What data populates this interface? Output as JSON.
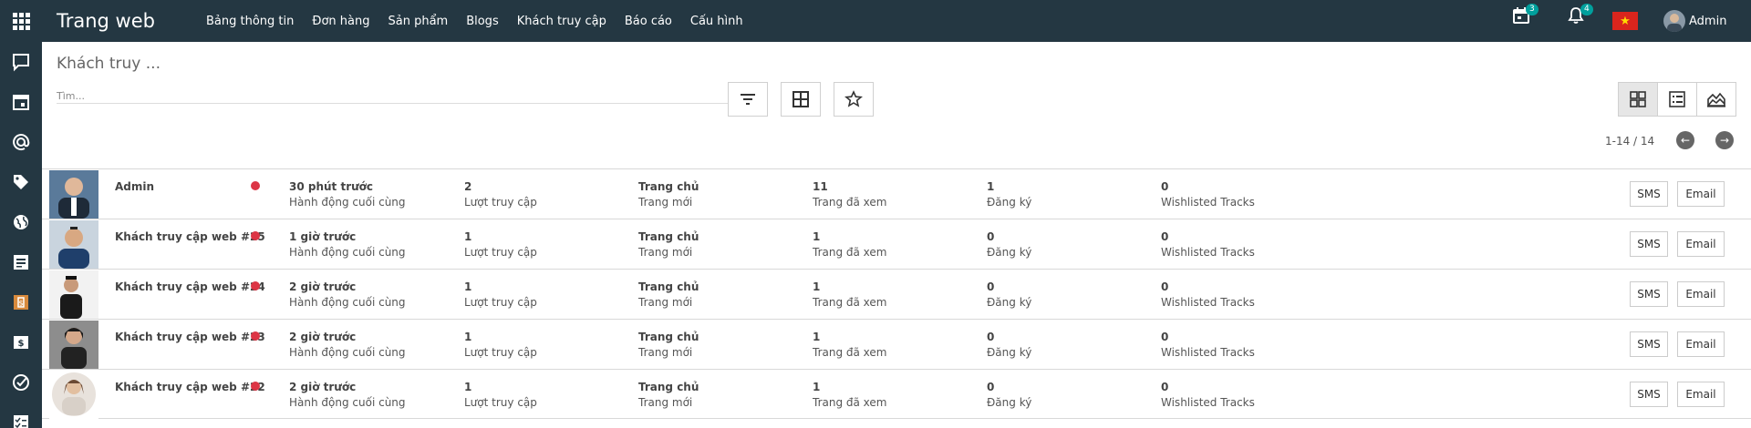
{
  "app": {
    "title": "Trang web",
    "apps_icon": "apps-grid-icon"
  },
  "menu": [
    "Bảng thông tin",
    "Đơn hàng",
    "Sản phẩm",
    "Blogs",
    "Khách truy cập",
    "Báo cáo",
    "Cấu hình"
  ],
  "systray": {
    "activity_count": "3",
    "notification_count": "4",
    "user_name": "Admin"
  },
  "sidebar": [
    "chat-icon",
    "calendar-icon",
    "at-icon",
    "tag-icon",
    "globe-icon",
    "document-icon",
    "clipboard-icon",
    "money-icon",
    "check-circle-icon",
    "tasks-icon"
  ],
  "control": {
    "title": "Khách truy ...",
    "search_placeholder": "Tìm...",
    "search_tail": "_ ·",
    "pager": "1-14 / 14"
  },
  "rows": [
    {
      "name": "Admin",
      "last_action": "30 phút trước",
      "visits": "2",
      "page": "Trang chủ",
      "pages_viewed": "11",
      "registrations": "1",
      "wishlisted": "0"
    },
    {
      "name": "Khách truy cập web #25",
      "last_action": "1 giờ trước",
      "visits": "1",
      "page": "Trang chủ",
      "pages_viewed": "1",
      "registrations": "0",
      "wishlisted": "0"
    },
    {
      "name": "Khách truy cập web #24",
      "last_action": "2 giờ trước",
      "visits": "1",
      "page": "Trang chủ",
      "pages_viewed": "1",
      "registrations": "0",
      "wishlisted": "0"
    },
    {
      "name": "Khách truy cập web #23",
      "last_action": "2 giờ trước",
      "visits": "1",
      "page": "Trang chủ",
      "pages_viewed": "1",
      "registrations": "0",
      "wishlisted": "0"
    },
    {
      "name": "Khách truy cập web #22",
      "last_action": "2 giờ trước",
      "visits": "1",
      "page": "Trang chủ",
      "pages_viewed": "1",
      "registrations": "0",
      "wishlisted": "0"
    }
  ],
  "labels": {
    "last_action": "Hành động cuối cùng",
    "visits": "Lượt truy cập",
    "page": "Trang mới",
    "pages_viewed": "Trang đã xem",
    "registrations": "Đăng ký",
    "wishlisted": "Wishlisted Tracks",
    "sms": "SMS",
    "email": "Email"
  },
  "colors": {
    "navbar": "#243742",
    "online_dot": "#dc3545",
    "badge": "#00a09d"
  }
}
